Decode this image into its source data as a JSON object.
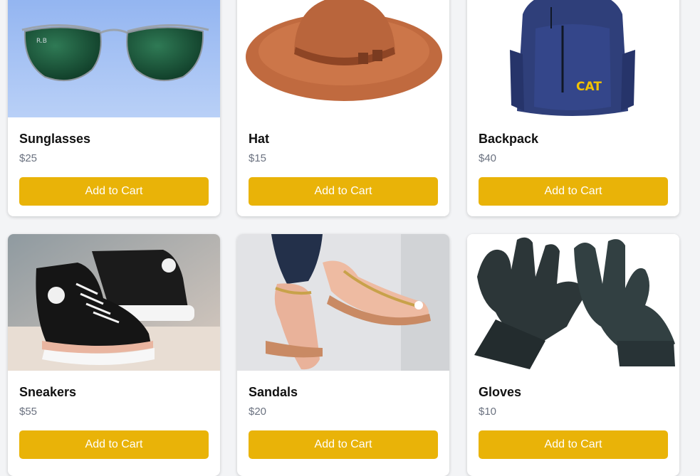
{
  "products": [
    {
      "name": "Sunglasses",
      "price": "$25",
      "button_label": "Add to Cart",
      "image_icon": "sunglasses-image"
    },
    {
      "name": "Hat",
      "price": "$15",
      "button_label": "Add to Cart",
      "image_icon": "hat-image"
    },
    {
      "name": "Backpack",
      "price": "$40",
      "button_label": "Add to Cart",
      "image_icon": "backpack-image"
    },
    {
      "name": "Sneakers",
      "price": "$55",
      "button_label": "Add to Cart",
      "image_icon": "sneakers-image"
    },
    {
      "name": "Sandals",
      "price": "$20",
      "button_label": "Add to Cart",
      "image_icon": "sandals-image"
    },
    {
      "name": "Gloves",
      "price": "$10",
      "button_label": "Add to Cart",
      "image_icon": "gloves-image"
    }
  ],
  "colors": {
    "accent": "#e9b308",
    "background": "#f3f4f6",
    "price_text": "#6b7280"
  }
}
